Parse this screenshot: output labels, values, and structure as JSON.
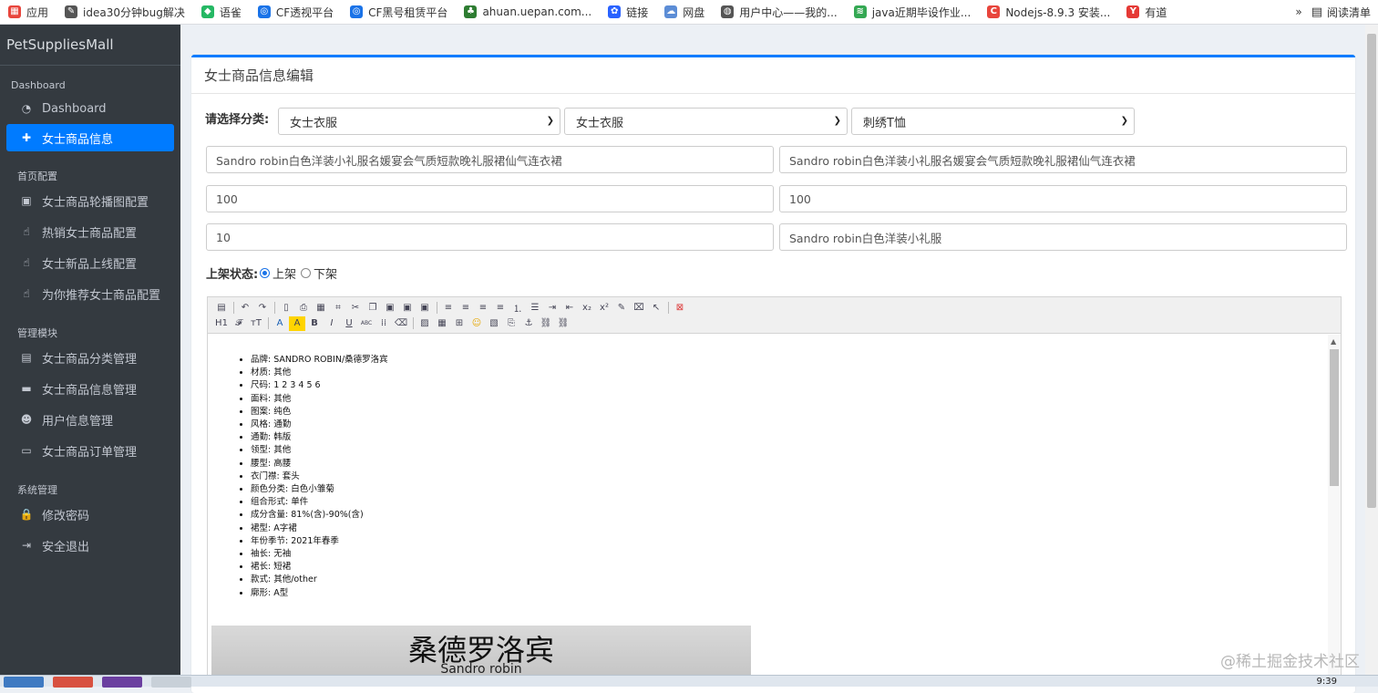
{
  "bookmarks": [
    {
      "label": "应用",
      "icon": "apps-grid-icon",
      "color": "#e8453c"
    },
    {
      "label": "idea30分钟bug解决",
      "icon": "idea-bookmark-icon",
      "color": "#555555"
    },
    {
      "label": "语雀",
      "icon": "yuque-icon",
      "color": "#25b864"
    },
    {
      "label": "CF透视平台",
      "icon": "cf-icon",
      "color": "#1a73e8"
    },
    {
      "label": "CF黑号租赁平台",
      "icon": "cf-rent-icon",
      "color": "#1a73e8"
    },
    {
      "label": "ahuan.uepan.com...",
      "icon": "tree-icon",
      "color": "#2e7d32"
    },
    {
      "label": "链接",
      "icon": "baidu-paw-icon",
      "color": "#2962ff"
    },
    {
      "label": "网盘",
      "icon": "cloud-disk-icon",
      "color": "#5c8dd6"
    },
    {
      "label": "用户中心——我的...",
      "icon": "globe-icon",
      "color": "#555555"
    },
    {
      "label": "java近期毕设作业...",
      "icon": "feather-icon",
      "color": "#34a853"
    },
    {
      "label": "Nodejs-8.9.3 安装...",
      "icon": "c-logo-icon",
      "color": "#e8453c"
    },
    {
      "label": "有道",
      "icon": "youdao-icon",
      "color": "#e53935"
    }
  ],
  "bookmark_more": "»",
  "reading_list": "阅读清单",
  "brand": "PetSuppliesMall",
  "sidebar": {
    "sections": [
      {
        "title": "Dashboard",
        "items": [
          {
            "label": "Dashboard",
            "icon": "dashboard-gauge-icon",
            "active": false
          },
          {
            "label": "女士商品信息",
            "icon": "plus-icon",
            "active": true
          }
        ]
      },
      {
        "title": "首页配置",
        "items": [
          {
            "label": "女士商品轮播图配置",
            "icon": "image-file-icon"
          },
          {
            "label": "热销女士商品配置",
            "icon": "hand-pointer-icon"
          },
          {
            "label": "女士新品上线配置",
            "icon": "hand-pointer-icon"
          },
          {
            "label": "为你推荐女士商品配置",
            "icon": "hand-pointer-icon"
          }
        ]
      },
      {
        "title": "管理模块",
        "items": [
          {
            "label": "女士商品分类管理",
            "icon": "list-alt-icon"
          },
          {
            "label": "女士商品信息管理",
            "icon": "credit-card-icon"
          },
          {
            "label": "用户信息管理",
            "icon": "users-icon"
          },
          {
            "label": "女士商品订单管理",
            "icon": "money-bill-icon"
          }
        ]
      },
      {
        "title": "系统管理",
        "items": [
          {
            "label": "修改密码",
            "icon": "lock-icon"
          },
          {
            "label": "安全退出",
            "icon": "sign-out-icon"
          }
        ]
      }
    ]
  },
  "card_title": "女士商品信息编辑",
  "form": {
    "category_label": "请选择分类:",
    "category1": "女士衣服",
    "category2": "女士衣服",
    "category3": "刺绣T恤",
    "goods_name": "Sandro robin白色洋装小礼服名媛宴会气质短款晚礼服裙仙气连衣裙",
    "goods_intro": "Sandro robin白色洋装小礼服名媛宴会气质短款晚礼服裙仙气连衣裙",
    "original_price": "100",
    "selling_price": "100",
    "stock": "10",
    "tag": "Sandro robin白色洋装小礼服",
    "status_label": "上架状态:",
    "status_on": "上架",
    "status_off": "下架",
    "status_selected": "上架"
  },
  "editor_toolbar": {
    "row1": [
      "source-icon",
      "|",
      "undo-icon",
      "redo-icon",
      "|",
      "preview-icon",
      "print-icon",
      "template-icon",
      "code-icon",
      "cut-icon",
      "copy-icon",
      "paste-icon",
      "paste-text-icon",
      "paste-word-icon",
      "|",
      "align-left-icon",
      "align-center-icon",
      "align-right-icon",
      "align-justify-icon",
      "ordered-list-icon",
      "unordered-list-icon",
      "indent-icon",
      "outdent-icon",
      "subscript-icon",
      "superscript-icon",
      "clear-format-icon",
      "select-all-icon",
      "pointer-icon",
      "|",
      "fullscreen-icon"
    ],
    "row2": [
      "heading-icon",
      "font-family-icon",
      "font-size-icon",
      "|",
      "font-color-icon",
      "highlight-icon",
      "bold-icon",
      "italic-icon",
      "underline-icon",
      "strikethrough-icon",
      "line-height-icon",
      "remove-format-icon",
      "|",
      "image-icon",
      "table-icon",
      "insert-icon",
      "emoticon-icon",
      "multi-image-icon",
      "page-break-icon",
      "anchor-icon",
      "link-icon",
      "unlink-icon"
    ]
  },
  "editor_content": [
    "品牌: SANDRO ROBIN/桑德罗洛宾",
    "材质: 其他",
    "尺码: 1 2 3 4 5 6",
    "面料: 其他",
    "图案: 纯色",
    "风格: 通勤",
    "通勤: 韩版",
    "领型: 其他",
    "腰型: 高腰",
    "衣门襟: 套头",
    "颜色分类: 白色小雏菊",
    "组合形式: 单件",
    "成分含量: 81%(含)-90%(含)",
    "裙型: A字裙",
    "年份季节: 2021年春季",
    "袖长: 无袖",
    "裙长: 短裙",
    "款式: 其他/other",
    "廓形: A型"
  ],
  "product_image": {
    "title": "桑德罗洛宾",
    "subtitle": "Sandro robin"
  },
  "watermark": "@稀土掘金技术社区",
  "taskbar_time": "9:39"
}
